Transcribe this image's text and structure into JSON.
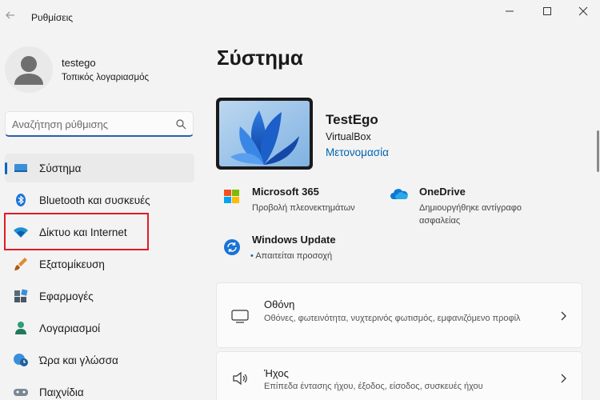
{
  "window": {
    "title": "Ρυθμίσεις"
  },
  "profile": {
    "name": "testego",
    "account_type": "Τοπικός λογαριασμός"
  },
  "search": {
    "placeholder": "Αναζήτηση ρύθμισης"
  },
  "sidebar": {
    "items": [
      {
        "label": "Σύστημα",
        "icon": "system-icon",
        "selected": true
      },
      {
        "label": "Bluetooth και συσκευές",
        "icon": "bluetooth-icon"
      },
      {
        "label": "Δίκτυο και Internet",
        "icon": "wifi-icon",
        "highlighted": true
      },
      {
        "label": "Εξατομίκευση",
        "icon": "brush-icon"
      },
      {
        "label": "Εφαρμογές",
        "icon": "apps-icon"
      },
      {
        "label": "Λογαριασμοί",
        "icon": "account-icon"
      },
      {
        "label": "Ώρα και γλώσσα",
        "icon": "globe-clock-icon"
      },
      {
        "label": "Παιχνίδια",
        "icon": "gamepad-icon"
      }
    ]
  },
  "main": {
    "title": "Σύστημα",
    "device": {
      "name": "TestEgo",
      "model": "VirtualBox",
      "rename_label": "Μετονομασία"
    },
    "tiles": [
      {
        "title": "Microsoft 365",
        "subtitle": "Προβολή πλεονεκτημάτων",
        "icon": "microsoft-365-icon"
      },
      {
        "title": "OneDrive",
        "subtitle": "Δημιουργήθηκε αντίγραφο ασφαλείας",
        "icon": "onedrive-icon"
      },
      {
        "title": "Windows Update",
        "subtitle": "Απαιτείται προσοχή",
        "bullet": "•",
        "icon": "windows-update-icon"
      }
    ],
    "cards": [
      {
        "title": "Οθόνη",
        "subtitle": "Οθόνες, φωτεινότητα, νυχτερινός φωτισμός, εμφανιζόμενο προφίλ",
        "icon": "monitor-icon"
      },
      {
        "title": "Ήχος",
        "subtitle": "Επίπεδα έντασης ήχου, έξοδος, είσοδος, συσκευές ήχου",
        "icon": "speaker-icon"
      }
    ]
  },
  "colors": {
    "accent": "#0067c0",
    "highlight_border": "#e11b22",
    "background": "#f3f3f3"
  }
}
